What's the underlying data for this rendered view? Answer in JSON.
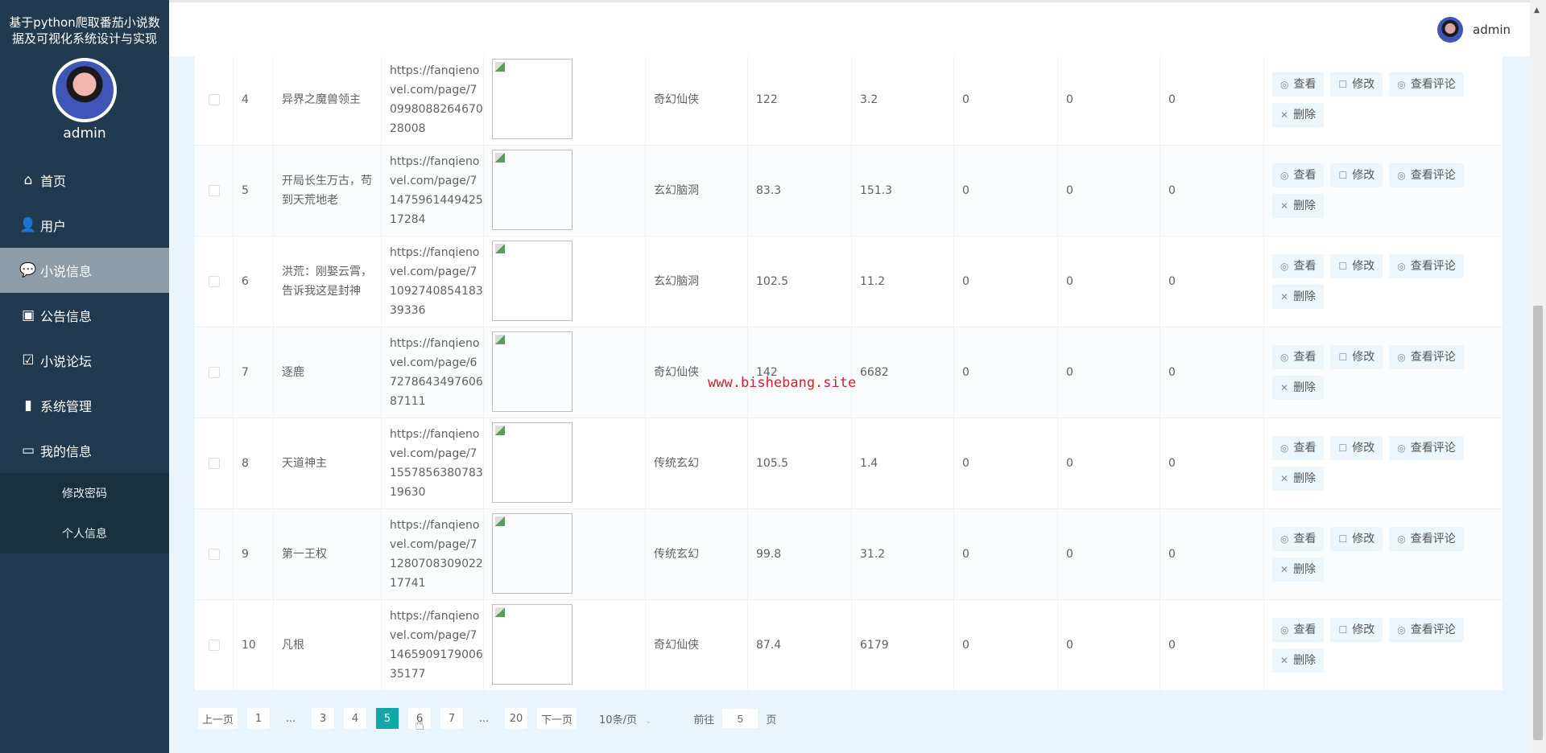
{
  "app": {
    "title": "基于python爬取番茄小说数据及可视化系统设计与实现",
    "username": "admin"
  },
  "sidebar": {
    "items": [
      {
        "label": "首页",
        "icon": "home-icon",
        "glyph": "⌂"
      },
      {
        "label": "用户",
        "icon": "user-icon",
        "glyph": "👤"
      },
      {
        "label": "小说信息",
        "icon": "chat-icon",
        "glyph": "💬"
      },
      {
        "label": "公告信息",
        "icon": "inbox-icon",
        "glyph": "▣"
      },
      {
        "label": "小说论坛",
        "icon": "clipboard-check-icon",
        "glyph": "☑"
      },
      {
        "label": "系统管理",
        "icon": "bar-chart-icon",
        "glyph": "▮"
      },
      {
        "label": "我的信息",
        "icon": "card-icon",
        "glyph": "▭"
      }
    ],
    "active_index": 2,
    "sub_items": [
      {
        "label": "修改密码"
      },
      {
        "label": "个人信息"
      }
    ]
  },
  "header": {
    "username": "admin"
  },
  "actions": {
    "view": "查看",
    "edit": "修改",
    "view_comments": "查看评论",
    "delete": "删除"
  },
  "table": {
    "rows": [
      {
        "index": "4",
        "name": "异界之魔兽领主",
        "url": "https://fanqienovel.com/page/7099808826467028008",
        "category": "奇幻仙侠",
        "v1": "122",
        "v2": "3.2",
        "v3": "0",
        "v4": "0",
        "v5": "0"
      },
      {
        "index": "5",
        "name": "开局长生万古，苟到天荒地老",
        "url": "https://fanqienovel.com/page/7147596144942517284",
        "category": "玄幻脑洞",
        "v1": "83.3",
        "v2": "151.3",
        "v3": "0",
        "v4": "0",
        "v5": "0"
      },
      {
        "index": "6",
        "name": "洪荒：刚娶云霄，告诉我这是封神",
        "url": "https://fanqienovel.com/page/7109274085418339336",
        "category": "玄幻脑洞",
        "v1": "102.5",
        "v2": "11.2",
        "v3": "0",
        "v4": "0",
        "v5": "0"
      },
      {
        "index": "7",
        "name": "逐鹿",
        "url": "https://fanqienovel.com/page/6727864349760687111",
        "category": "奇幻仙侠",
        "v1": "142",
        "v2": "6682",
        "v3": "0",
        "v4": "0",
        "v5": "0"
      },
      {
        "index": "8",
        "name": "天道神主",
        "url": "https://fanqienovel.com/page/7155785638078319630",
        "category": "传统玄幻",
        "v1": "105.5",
        "v2": "1.4",
        "v3": "0",
        "v4": "0",
        "v5": "0"
      },
      {
        "index": "9",
        "name": "第一王权",
        "url": "https://fanqienovel.com/page/7128070830902217741",
        "category": "传统玄幻",
        "v1": "99.8",
        "v2": "31.2",
        "v3": "0",
        "v4": "0",
        "v5": "0"
      },
      {
        "index": "10",
        "name": "凡根",
        "url": "https://fanqienovel.com/page/7146590917900635177",
        "category": "奇幻仙侠",
        "v1": "87.4",
        "v2": "6179",
        "v3": "0",
        "v4": "0",
        "v5": "0"
      }
    ]
  },
  "pagination": {
    "prev": "上一页",
    "next": "下一页",
    "pages": [
      "1",
      "...",
      "3",
      "4",
      "5",
      "6",
      "7",
      "...",
      "20"
    ],
    "current": "5",
    "page_size": "10条/页",
    "goto_label": "前往",
    "goto_value": "5",
    "goto_suffix": "页"
  },
  "watermark": "www.bishebang.site",
  "colors": {
    "sidebar": "#213a4f",
    "active": "#13a8a8",
    "background": "#eaf4fc"
  }
}
